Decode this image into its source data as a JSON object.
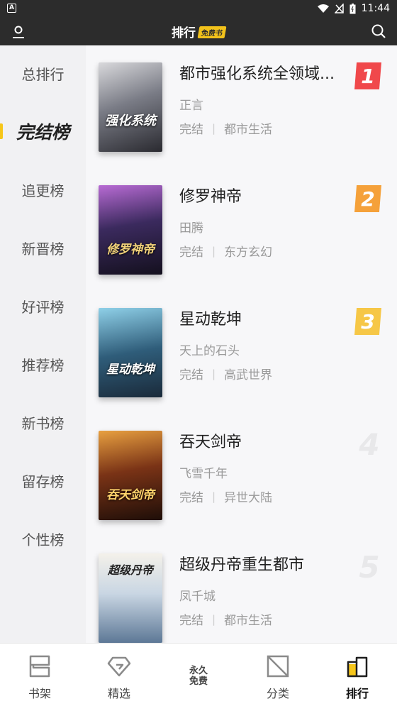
{
  "status_bar": {
    "time": "11:44"
  },
  "header": {
    "title": "排行",
    "badge": "免费书"
  },
  "sidebar": {
    "items": [
      {
        "label": "总排行",
        "active": false
      },
      {
        "label": "完结榜",
        "active": true
      },
      {
        "label": "追更榜",
        "active": false
      },
      {
        "label": "新晋榜",
        "active": false
      },
      {
        "label": "好评榜",
        "active": false
      },
      {
        "label": "推荐榜",
        "active": false
      },
      {
        "label": "新书榜",
        "active": false
      },
      {
        "label": "留存榜",
        "active": false
      },
      {
        "label": "个性榜",
        "active": false
      }
    ]
  },
  "books": [
    {
      "rank": "1",
      "title": "都市强化系统全领域...",
      "author": "正言",
      "status": "完结",
      "category": "都市生活",
      "cover_text": "强化系统",
      "cover_color": "#6d6f78"
    },
    {
      "rank": "2",
      "title": "修罗神帝",
      "author": "田腾",
      "status": "完结",
      "category": "东方玄幻",
      "cover_text": "修罗神帝",
      "cover_color": "#3b2a5e"
    },
    {
      "rank": "3",
      "title": "星动乾坤",
      "author": "天上的石头",
      "status": "完结",
      "category": "高武世界",
      "cover_text": "星动乾坤",
      "cover_color": "#2f5d7a"
    },
    {
      "rank": "4",
      "title": "吞天剑帝",
      "author": "飞雪千年",
      "status": "完结",
      "category": "异世大陆",
      "cover_text": "吞天剑帝",
      "cover_color": "#7a3316"
    },
    {
      "rank": "5",
      "title": "超级丹帝重生都市",
      "author": "凤千城",
      "status": "完结",
      "category": "都市生活",
      "cover_text": "超级丹帝",
      "cover_color": "#8fa6c0"
    }
  ],
  "bottom_nav": {
    "items": [
      {
        "label": "书架",
        "icon": "bookshelf-icon"
      },
      {
        "label": "精选",
        "icon": "diamond-icon"
      },
      {
        "badge_line1": "永久",
        "badge_line2": "免费"
      },
      {
        "label": "分类",
        "icon": "category-icon"
      },
      {
        "label": "排行",
        "icon": "ranking-icon",
        "active": true
      }
    ]
  }
}
